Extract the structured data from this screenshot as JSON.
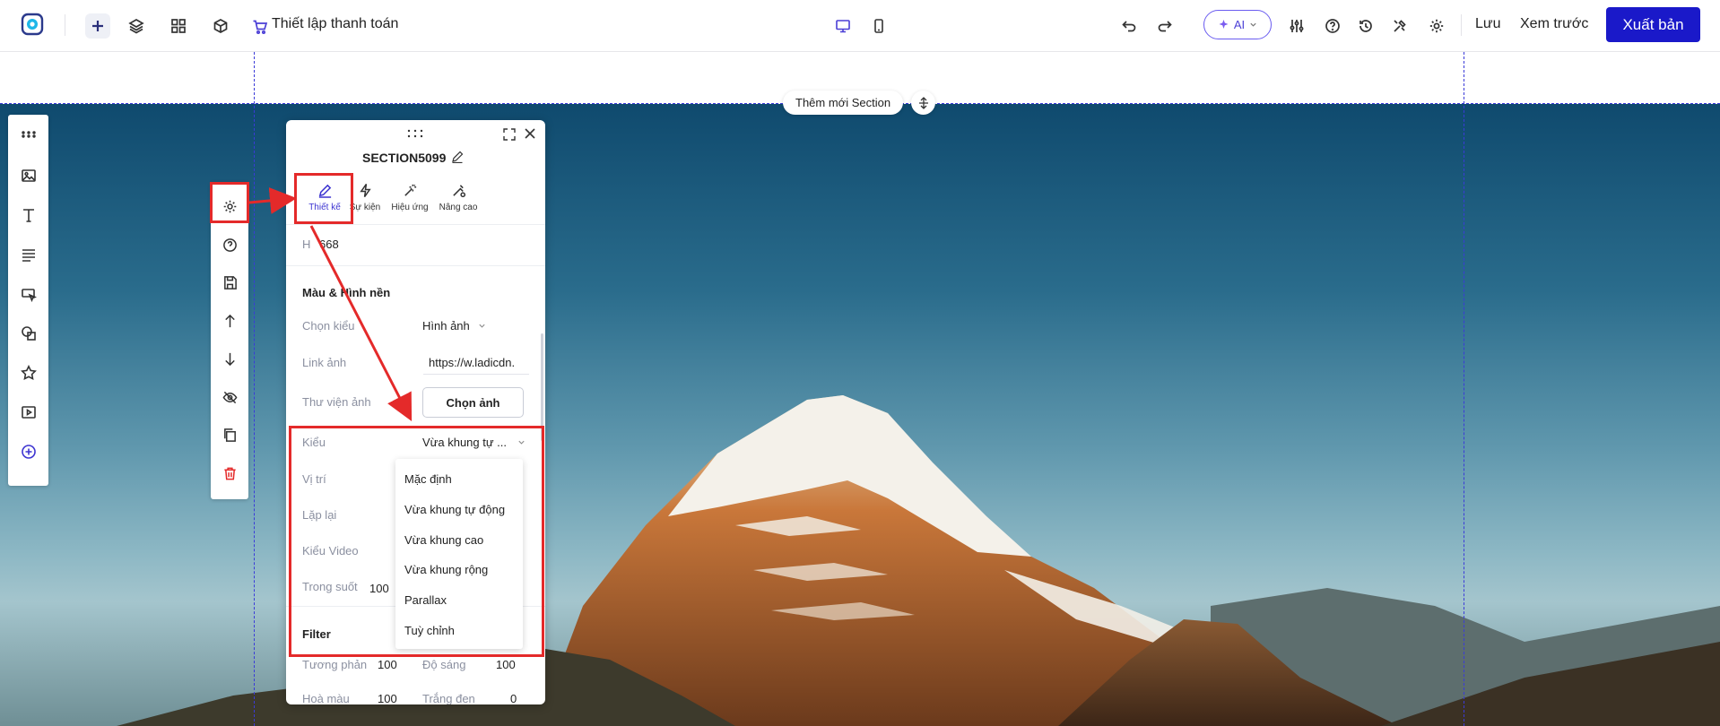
{
  "topbar": {
    "page_title": "Thiết lập thanh toán",
    "ai_label": "AI",
    "save_label": "Lưu",
    "preview_label": "Xem trước",
    "publish_label": "Xuất bản"
  },
  "canvas": {
    "add_section_label": "Thêm mới Section"
  },
  "panel": {
    "title": "SECTION5099",
    "tabs": [
      {
        "label": "Thiết kế",
        "icon": "edit-icon",
        "active": true
      },
      {
        "label": "Sự kiện",
        "icon": "lightning-icon",
        "active": false
      },
      {
        "label": "Hiệu ứng",
        "icon": "magic-wand-icon",
        "active": false
      },
      {
        "label": "Nâng cao",
        "icon": "advanced-icon",
        "active": false
      }
    ],
    "height_label": "H",
    "height_value": "668",
    "bg_section_title": "Màu & Hình nền",
    "style_label": "Chọn kiểu",
    "style_value": "Hình ảnh",
    "image_link_label": "Link ảnh",
    "image_link_value": "https://w.ladicdn.",
    "library_label": "Thư viện ảnh",
    "choose_image_label": "Chọn ảnh",
    "type_label": "Kiểu",
    "type_value": "Vừa khung tự ...",
    "position_label": "Vị trí",
    "repeat_label": "Lặp lại",
    "video_type_label": "Kiểu Video",
    "opacity_label": "Trong suốt",
    "opacity_value": "100",
    "filter_title": "Filter",
    "contrast_label": "Tương phản",
    "contrast_value": "100",
    "brightness_label": "Độ sáng",
    "brightness_value": "100",
    "hue_label": "Hoà màu",
    "hue_value": "100",
    "grayscale_label": "Trắng đen",
    "grayscale_value": "0"
  },
  "type_dropdown": {
    "options": [
      "Mặc định",
      "Vừa khung tự động",
      "Vừa khung cao",
      "Vừa khung rộng",
      "Parallax",
      "Tuỳ chỉnh"
    ]
  },
  "colors": {
    "accent": "#1a19c9",
    "annotation_red": "#e42a2a",
    "active_tab": "#3d34d1"
  }
}
